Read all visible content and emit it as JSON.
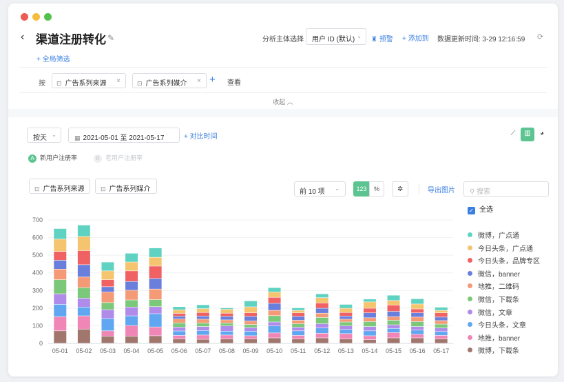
{
  "title": "渠道注册转化",
  "header": {
    "subject_label": "分析主体选择",
    "subject_value": "用户 ID (默认)",
    "warn": "预警",
    "add_to": "添加到",
    "update_time": "数据更新时间: 3-29 12:16:59"
  },
  "filters": {
    "global": "+ 全局筛选",
    "by_label": "按",
    "chips": [
      "广告系列来源",
      "广告系列媒介"
    ],
    "view": "查看",
    "collapse": "收起 ︿"
  },
  "controls": {
    "granularity": "按天",
    "date_range": "2021-05-01 至 2021-05-17",
    "compare": "+ 对比时间"
  },
  "metrics": [
    {
      "badge": "A",
      "label": "新用户注册率",
      "active": true
    },
    {
      "badge": "B",
      "label": "老用户注册率",
      "active": false
    }
  ],
  "toolbar": {
    "dim_buttons": [
      "广告系列来源",
      "广告系列媒介"
    ],
    "topn": "前 10 项",
    "seg_num": "123",
    "seg_pct": "%",
    "export": "导出图片",
    "search_placeholder": "搜索"
  },
  "legend": {
    "select_all": "全选"
  },
  "chart_data": {
    "type": "bar",
    "stacked": true,
    "categories": [
      "05-01",
      "05-02",
      "05-03",
      "05-04",
      "05-05",
      "05-06",
      "05-07",
      "05-08",
      "05-09",
      "05-10",
      "05-11",
      "05-12",
      "05-13",
      "05-14",
      "05-15",
      "05-16",
      "05-17"
    ],
    "ylim": [
      0,
      700
    ],
    "yticks": [
      0,
      100,
      200,
      300,
      400,
      500,
      600,
      700
    ],
    "grid": true,
    "series": [
      {
        "name": "微博，下载条",
        "color": "#a1766d",
        "values": [
          70,
          80,
          40,
          40,
          42,
          24,
          22,
          24,
          24,
          30,
          24,
          30,
          24,
          20,
          30,
          30,
          24
        ]
      },
      {
        "name": "地推，banner",
        "color": "#ef86b5",
        "values": [
          80,
          75,
          30,
          60,
          50,
          20,
          24,
          22,
          18,
          28,
          20,
          26,
          30,
          22,
          30,
          20,
          20
        ]
      },
      {
        "name": "今日头条，文章",
        "color": "#61a6f0",
        "values": [
          70,
          50,
          70,
          55,
          75,
          25,
          26,
          22,
          26,
          40,
          26,
          30,
          24,
          28,
          24,
          24,
          22
        ]
      },
      {
        "name": "微信，文章",
        "color": "#b08bea",
        "values": [
          60,
          50,
          50,
          50,
          40,
          22,
          22,
          30,
          20,
          22,
          20,
          24,
          20,
          24,
          20,
          20,
          20
        ]
      },
      {
        "name": "微信，下载条",
        "color": "#7cc87a",
        "values": [
          80,
          60,
          40,
          40,
          40,
          24,
          20,
          16,
          18,
          36,
          20,
          36,
          22,
          28,
          26,
          28,
          22
        ]
      },
      {
        "name": "地推，二维码",
        "color": "#f59a76",
        "values": [
          60,
          60,
          60,
          55,
          60,
          22,
          22,
          18,
          20,
          30,
          20,
          24,
          16,
          22,
          20,
          26,
          20
        ]
      },
      {
        "name": "微信，banner",
        "color": "#6a7fdc",
        "values": [
          50,
          70,
          30,
          50,
          60,
          16,
          18,
          20,
          26,
          40,
          22,
          28,
          18,
          28,
          30,
          24,
          20
        ]
      },
      {
        "name": "今日头条，品牌专区",
        "color": "#ef6163",
        "values": [
          50,
          80,
          40,
          60,
          70,
          16,
          20,
          18,
          20,
          34,
          20,
          30,
          20,
          26,
          36,
          22,
          24
        ]
      },
      {
        "name": "今日头条，广点通",
        "color": "#f5c46e",
        "values": [
          70,
          80,
          50,
          50,
          50,
          20,
          22,
          22,
          34,
          30,
          14,
          30,
          24,
          36,
          26,
          28,
          14
        ]
      },
      {
        "name": "微博，广点通",
        "color": "#5fd2c1",
        "values": [
          60,
          65,
          50,
          50,
          53,
          18,
          22,
          8,
          34,
          25,
          14,
          22,
          22,
          16,
          30,
          30,
          18
        ]
      }
    ]
  }
}
